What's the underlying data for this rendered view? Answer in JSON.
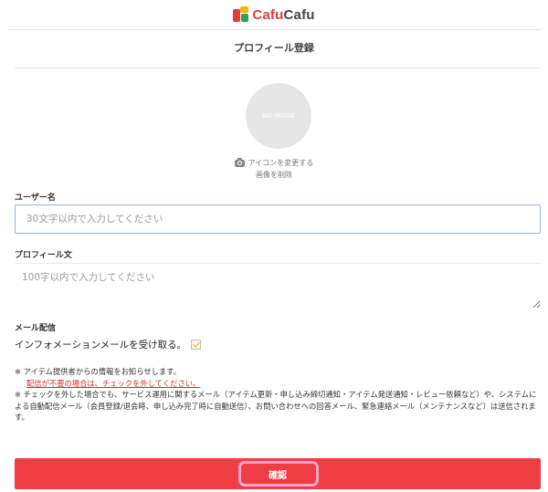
{
  "header": {
    "logo_prefix": "Cafu",
    "logo_suffix": "Cafu"
  },
  "page": {
    "title": "プロフィール登録"
  },
  "avatar": {
    "placeholder_text": "NO IMAGE",
    "change_icon_label": "アイコンを変更する",
    "delete_image_label": "画像を削除"
  },
  "form": {
    "username": {
      "label": "ユーザー名",
      "value": "",
      "placeholder": "30文字以内で入力してください"
    },
    "profile": {
      "label": "プロフィール文",
      "value": "",
      "placeholder": "100字以内で入力してください"
    },
    "mail": {
      "label": "メール配信",
      "checkbox_label": "インフォメーションメールを受け取る。",
      "checked": true
    }
  },
  "notes": {
    "line1": "※ アイテム提供者からの情報をお知らせします。",
    "link": "配信が不要の場合は、チェックを外してください。",
    "line2": "※ チェックを外した場合でも、サービス運用に関するメール（アイテム更新・申し込み締切通知・アイテム発送通知・レビュー依頼など）や、システムによる自動配信メール（会員登録/退会時、申し込み完了時に自動送信）、お問い合わせへの回答メール、緊急連絡メール（メンテナンスなど）は送信されます。"
  },
  "actions": {
    "confirm_label": "確認"
  },
  "colors": {
    "brand_red": "#e73b3b",
    "button_red": "#ef3d43",
    "highlight_pink": "#f4a6c8",
    "checkmark_yellow": "#e3a800"
  }
}
